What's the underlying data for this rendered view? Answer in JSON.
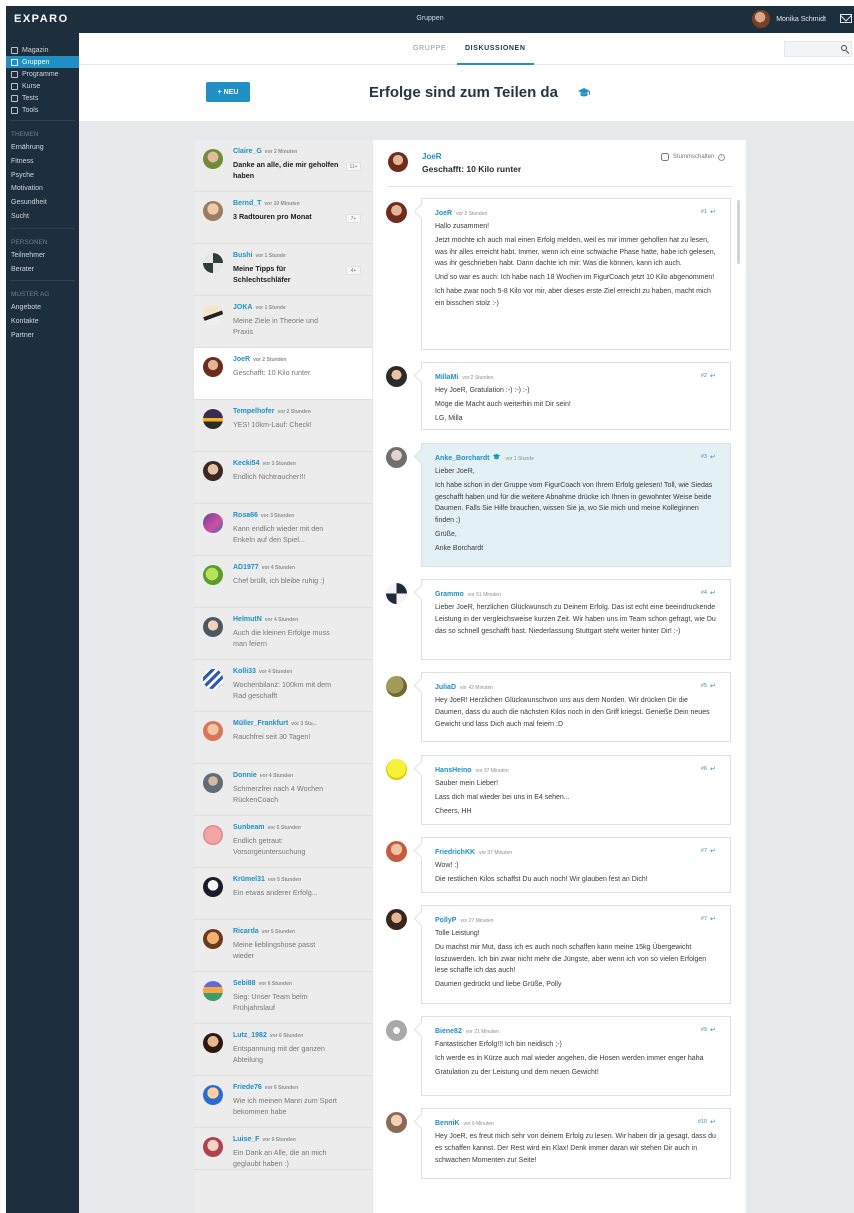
{
  "app": {
    "logo": "EXPARO",
    "title": "Gruppen",
    "user_name": "Monika Schmidt"
  },
  "sidebar": {
    "main": [
      {
        "label": "Magazin",
        "active": false
      },
      {
        "label": "Gruppen",
        "active": true
      },
      {
        "label": "Programme",
        "active": false
      },
      {
        "label": "Kurse",
        "active": false
      },
      {
        "label": "Tests",
        "active": false
      },
      {
        "label": "Tools",
        "active": false
      }
    ],
    "sections": [
      {
        "heading": "THEMEN",
        "items": [
          "Ernährung",
          "Fitness",
          "Psyche",
          "Motivation",
          "Gesundheit",
          "Sucht"
        ]
      },
      {
        "heading": "PERSONEN",
        "items": [
          "Teilnehmer",
          "Berater"
        ]
      },
      {
        "heading": "MUSTER AG",
        "items": [
          "Angebote",
          "Kontakte",
          "Partner"
        ]
      }
    ]
  },
  "tabs": [
    {
      "label": "GRUPPE",
      "active": false
    },
    {
      "label": "DISKUSSIONEN",
      "active": true
    }
  ],
  "search": {
    "placeholder": "",
    "icon": "search-icon"
  },
  "hero": {
    "new_button": "+ NEU",
    "title": "Erfolge sind zum Teilen da",
    "title_icon": "graduation-cap-icon"
  },
  "threads": [
    {
      "user": "Claire_G",
      "time": "vor 2 Minuten",
      "title": "Danke an alle, die mir geholfen haben",
      "badge": "11+",
      "unread": true,
      "active": false
    },
    {
      "user": "Bernd_T",
      "time": "vor 10 Minuten",
      "title": "3 Radtouren pro Monat",
      "badge": "7+",
      "unread": true,
      "active": false
    },
    {
      "user": "Bushi",
      "time": "vor 1 Stunde",
      "title": "Meine Tipps für Schlechtschläfer",
      "badge": "4+",
      "unread": true,
      "active": false
    },
    {
      "user": "JOKA",
      "time": "vor 1 Stunde",
      "title": "Meine Ziele in Theorie und Praxis",
      "badge": "",
      "unread": false,
      "active": false
    },
    {
      "user": "JoeR",
      "time": "vor 2 Stunden",
      "title": "Geschafft: 10 Kilo runter",
      "badge": "",
      "unread": false,
      "active": true
    },
    {
      "user": "Tempelhofer",
      "time": "vor 2 Stunden",
      "title": "YES! 10km-Lauf: Check!",
      "badge": "",
      "unread": false,
      "active": false
    },
    {
      "user": "Kecki54",
      "time": "vor 3 Stunden",
      "title": "Endlich Nichtraucher!!!",
      "badge": "",
      "unread": false,
      "active": false
    },
    {
      "user": "Rosa66",
      "time": "vor 3 Stunden",
      "title": "Kann endlich wieder mit den Enkeln auf den Spiel...",
      "badge": "",
      "unread": false,
      "active": false
    },
    {
      "user": "AD1977",
      "time": "vor 4 Stunden",
      "title": "Chef brüllt, ich bleibe ruhig :)",
      "badge": "",
      "unread": false,
      "active": false
    },
    {
      "user": "HelmutN",
      "time": "vor 4 Stunden",
      "title": "Auch die kleinen Erfolge muss man feiern",
      "badge": "",
      "unread": false,
      "active": false
    },
    {
      "user": "Kolli33",
      "time": "vor 4 Stunden",
      "title": "Wochenbilanz: 100km mit dem Rad geschafft",
      "badge": "",
      "unread": false,
      "active": false
    },
    {
      "user": "Müller_Frankfurt",
      "time": "vor 3 Stu...",
      "title": "Rauchfrei seit 30 Tagen!",
      "badge": "",
      "unread": false,
      "active": false
    },
    {
      "user": "Donnie",
      "time": "vor 4 Stunden",
      "title": "Schmerzfrei nach 4 Wochen RückenCoach",
      "badge": "",
      "unread": false,
      "active": false
    },
    {
      "user": "Sunbeam",
      "time": "vor 5 Stunden",
      "title": "Endlich getraut: Vorsorgeuntersuchung",
      "badge": "",
      "unread": false,
      "active": false
    },
    {
      "user": "Krümel31",
      "time": "vor 5 Stunden",
      "title": "Ein etwas anderer Erfolg...",
      "badge": "",
      "unread": false,
      "active": false
    },
    {
      "user": "Ricarda",
      "time": "vor 5 Stunden",
      "title": "Meine lieblingshose passt wieder",
      "badge": "",
      "unread": false,
      "active": false
    },
    {
      "user": "Sebi88",
      "time": "vor 6 Stunden",
      "title": "Sieg: Unser Team beim Frühjahrslauf",
      "badge": "",
      "unread": false,
      "active": false
    },
    {
      "user": "Lutz_1982",
      "time": "vor 6 Stunden",
      "title": "Entspannung mit der ganzen Abteilung",
      "badge": "",
      "unread": false,
      "active": false
    },
    {
      "user": "Friede76",
      "time": "vor 6 Stunden",
      "title": "Wie ich meinen Mann zum Sport bekommen habe",
      "badge": "",
      "unread": false,
      "active": false
    },
    {
      "user": "Luise_F",
      "time": "vor 6 Stunden",
      "title": "Ein Dank an Alle, die an mich geglaubt haben :)",
      "badge": "",
      "unread": false,
      "active": false
    }
  ],
  "discussion": {
    "author": "JoeR",
    "title": "Geschafft: 10 Kilo runter",
    "mute_label": "Stummschalten",
    "info_icon": "info-icon",
    "posts": [
      {
        "user": "JoeR",
        "time": "vor 2 Stunden",
        "num": "#1",
        "highlight": false,
        "lines": [
          "Hallo zusammen!",
          "Jetzt möchte ich auch mal einen Erfolg melden, weil es mir immer geholfen hat zu lesen, was ihr alles erreicht habt. Immer, wenn ich eine schwache Phase hatte, habe ich gelesen, was ihr geschrieben habt. Dann dachte ich mir: Was die können, kann ich auch.",
          "Und so war es auch: Ich habe nach 18 Wochen im FigurCoach jetzt 10 Kilo abgenommen!",
          "Ich habe zwar noch 5-8 Kilo vor mir, aber dieses erste Ziel erreicht zu haben, macht mich ein bisschen stolz :-)"
        ]
      },
      {
        "user": "MillaMi",
        "time": "vor 2 Stunden",
        "num": "#2",
        "highlight": false,
        "lines": [
          "Hey JoeR, Gratulation :-) :-) :-)",
          "Möge die Macht auch weiterhin mit Dir sein!",
          "LG, Milla"
        ]
      },
      {
        "user": "Anke_Borchardt",
        "time": "vor 1 Stunde",
        "num": "#3",
        "highlight": true,
        "badge_icon": "graduation-cap-icon",
        "lines": [
          "Lieber JoeR,",
          "Ich habe schon in der Gruppe vom FigurCoach von Ihrem Erfolg gelesen! Toll, wie Siedas geschafft haben und für die weitere Abnahme drücke ich Ihnen in gewohnter Weise beide Daumen. Falls Sie Hilfe brauchen, wissen Sie ja, wo Sie mich und meine Kolleginnen finden ;)",
          "Grüße,",
          "Anke Borchardt"
        ]
      },
      {
        "user": "Grammo",
        "time": "vor 51 Minuten",
        "num": "#4",
        "highlight": false,
        "lines": [
          "Lieber JoeR, herzlichen Glückwunsch zu Deinem Erfolg. Das ist echt eine beeindruckende Leistung in der vergleichsweise kurzen Zeit. Wir haben uns im Team schon gefragt, wie Du das so schnell geschafft hast. Niederlassung Stuttgart steht weiter hinter Dir! :-)"
        ]
      },
      {
        "user": "JuliaD",
        "time": "vor 42 Minuten",
        "num": "#5",
        "highlight": false,
        "lines": [
          "Hey JoeR! Herzlichen Glückwunschvon uns aus dem Norden. Wir drücken Dir die Daumen, dass du auch die nächsten Kilos noch in den Griff kriegst. Genieße Dein neues Gewicht und lass Dich auch mal feiern :D"
        ]
      },
      {
        "user": "HansHeino",
        "time": "vor 37 Minuten",
        "num": "#6",
        "highlight": false,
        "lines": [
          "Sauber mein Lieber!",
          "Lass dich mal wieder bei uns in E4 sehen...",
          "Cheers, HH"
        ]
      },
      {
        "user": "FriedrichKK",
        "time": "vor 37 Minuten",
        "num": "#7",
        "highlight": false,
        "lines": [
          "Wow! :)",
          "Die restlichen Kilos schaffst Du auch noch! Wir glauben fest an Dich!"
        ]
      },
      {
        "user": "PollyP",
        "time": "vor 27 Minuten",
        "num": "#7",
        "highlight": false,
        "lines": [
          "Tolle Leistung!",
          "Du machst mir Mut, dass ich es auch noch schaffen kann meine 15kg Übergewicht loszuwerden. Ich bin zwar nicht mehr die Jüngste, aber wenn ich von so vielen Erfolgen lese schaffe ich das auch!",
          "Daumen gedrückt und liebe Grüße, Polly"
        ]
      },
      {
        "user": "Biene82",
        "time": "vor 21 Minuten",
        "num": "#9",
        "highlight": false,
        "lines": [
          "Fantastischer Erfolg!!! Ich bin neidisch ;-)",
          "Ich werde es in Kürze auch mal wieder angehen, die Hosen werden immer enger haha",
          "Gratulation zu der Leistung und dem neuen Gewicht!"
        ]
      },
      {
        "user": "BenniK",
        "time": "vor 9 Minuten",
        "num": "#10",
        "highlight": false,
        "lines": [
          "Hey JoeR, es freut mich sehr von deinem Erfolg zu lesen. Wir haben dir ja gesagt, dass du es schaffen kannst. Der Rest wird ein Klax! Denk immer daran wir stehen Dir auch in schwachen Momenten zur Seite!"
        ]
      }
    ]
  }
}
